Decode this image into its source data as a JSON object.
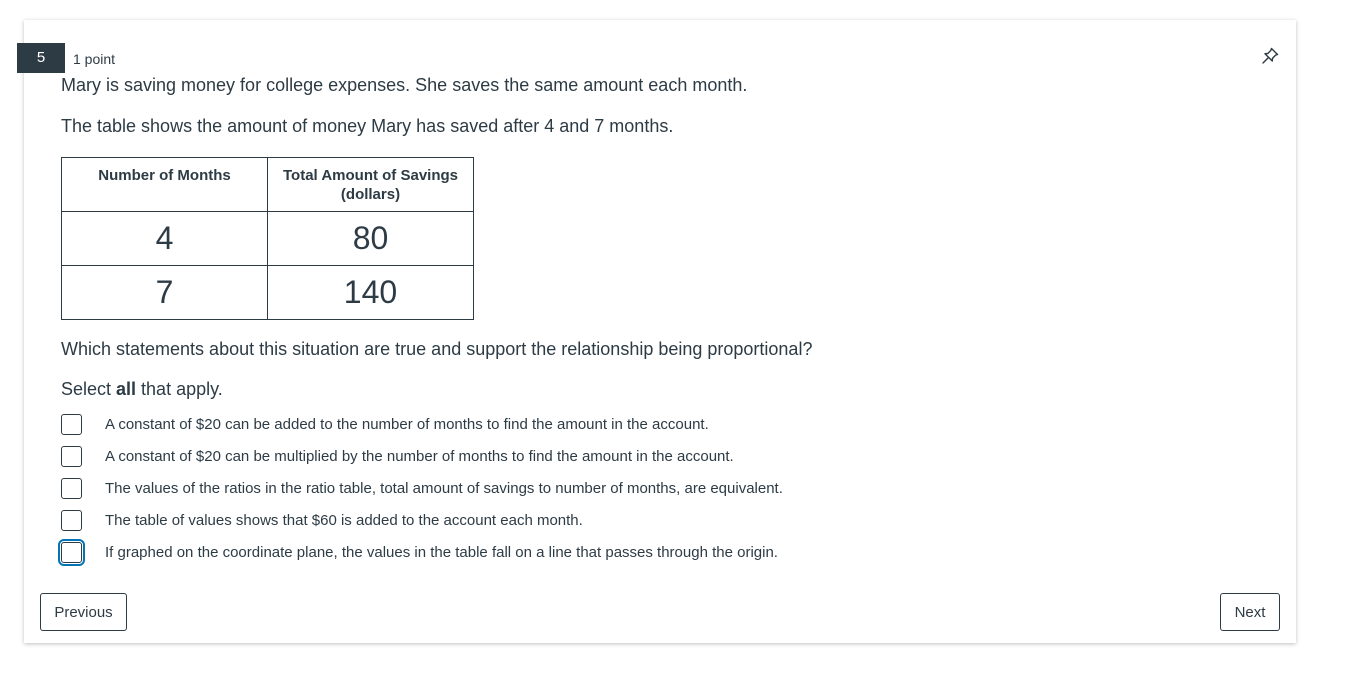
{
  "question": {
    "number": "5",
    "points": "1 point",
    "intro_line1": "Mary is saving money for college expenses. She saves the same amount each month.",
    "intro_line2": "The table shows the amount of money Mary has saved after 4 and 7 months.",
    "prompt": "Which statements about this situation are true and support the relationship being proportional?",
    "instruction_pre": "Select ",
    "instruction_bold": "all",
    "instruction_post": " that apply."
  },
  "table": {
    "headers": [
      "Number of Months",
      "Total Amount of Savings (dollars)"
    ],
    "rows": [
      [
        "4",
        "80"
      ],
      [
        "7",
        "140"
      ]
    ]
  },
  "options": [
    "A constant of $20 can be added to the number of months to find the amount in the account.",
    "A constant of $20 can be multiplied by the number of months to find the amount in the account.",
    "The values of the ratios in the ratio table, total amount of savings to number of months, are equivalent.",
    "The table of values shows that $60 is added to the account each month.",
    "If graphed on the coordinate plane, the values in the table fall on a line that passes through the origin."
  ],
  "navigation": {
    "previous_label": "Previous",
    "next_label": "Next"
  },
  "icons": {
    "pin": "pin-icon"
  },
  "colors": {
    "text": "#2d3b45",
    "focus": "#0374b5"
  }
}
